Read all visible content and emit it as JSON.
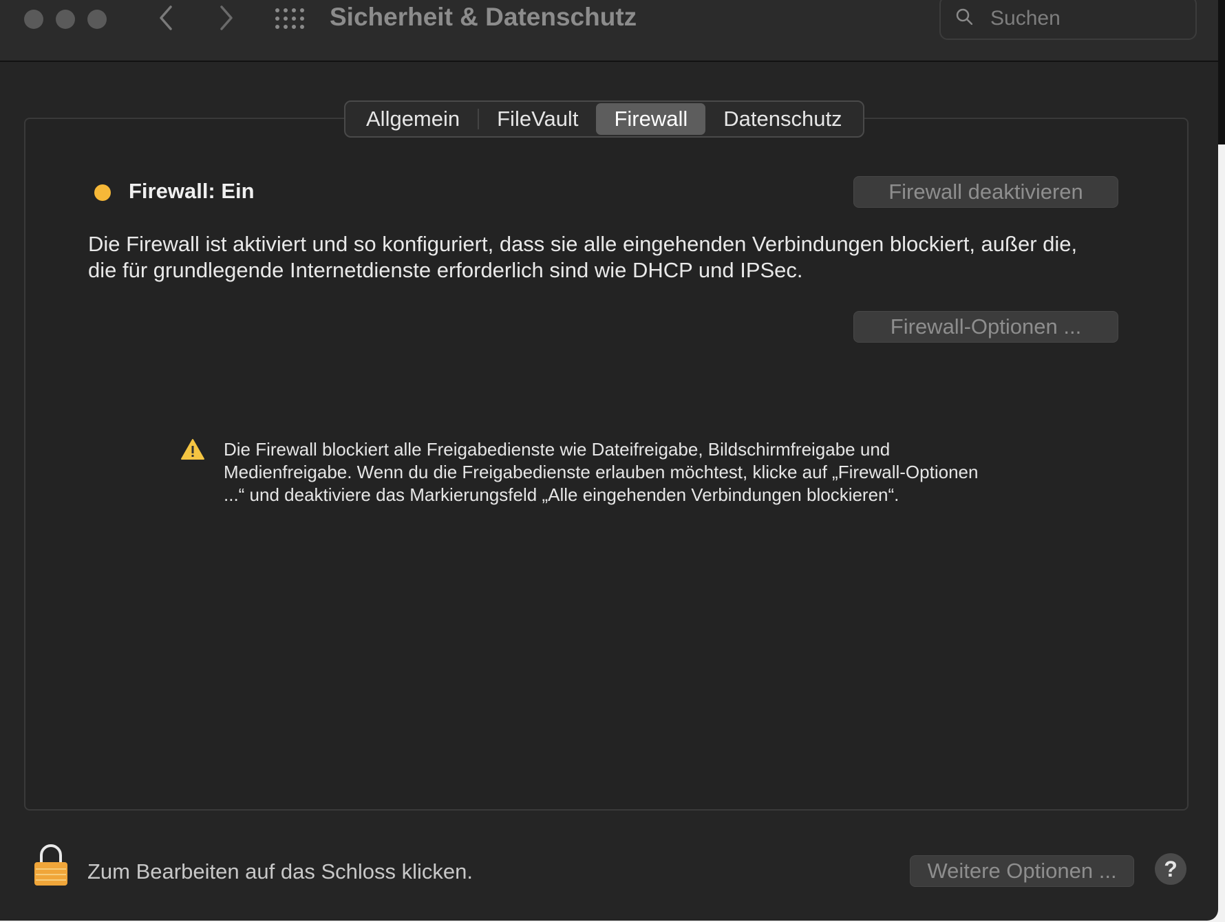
{
  "window": {
    "title": "Sicherheit & Datenschutz"
  },
  "toolbar": {
    "back_icon": "chevron-left-icon",
    "forward_icon": "chevron-right-icon",
    "show_all_icon": "grid-icon"
  },
  "search": {
    "placeholder": "Suchen",
    "value": ""
  },
  "tabs": [
    {
      "label": "Allgemein",
      "active": false
    },
    {
      "label": "FileVault",
      "active": false
    },
    {
      "label": "Firewall",
      "active": true
    },
    {
      "label": "Datenschutz",
      "active": false
    }
  ],
  "firewall": {
    "status": "Firewall: Ein",
    "status_color": "#f6b838",
    "deactivate_label": "Firewall deaktivieren",
    "description": "Die Firewall ist aktiviert und so konfiguriert, dass sie alle eingehenden Verbindungen blockiert, außer die, die für grundlegende Internetdienste erforderlich sind wie DHCP und IPSec.",
    "options_label": "Firewall-Optionen ...",
    "warning": "Die Firewall blockiert alle Freigabedienste wie Dateifreigabe, Bildschirmfreigabe und Medienfreigabe. Wenn du die Freigabedienste erlauben möchtest, klicke auf „Firewall-Optionen ...“ und deaktiviere das Markierungsfeld „Alle eingehenden Verbindungen blockieren“."
  },
  "footer": {
    "lock_text": "Zum Bearbeiten auf das Schloss klicken.",
    "advanced_label": "Weitere Optionen ...",
    "help_label": "?"
  }
}
